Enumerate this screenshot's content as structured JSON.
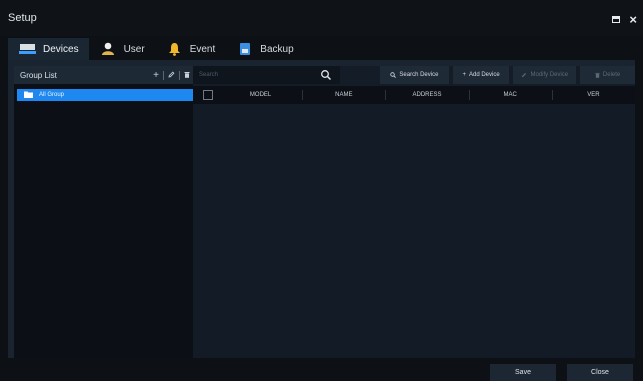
{
  "window": {
    "title": "Setup",
    "maximize_icon": "maximize-icon",
    "close_label": "×"
  },
  "tabs": [
    {
      "label": "Devices",
      "icon": "devices-icon",
      "active": true
    },
    {
      "label": "User",
      "icon": "user-icon",
      "active": false
    },
    {
      "label": "Event",
      "icon": "bell-icon",
      "active": false
    },
    {
      "label": "Backup",
      "icon": "backup-icon",
      "active": false
    }
  ],
  "group_panel": {
    "title": "Group List",
    "add_label": "+",
    "items": [
      {
        "label": "All Group",
        "selected": true
      }
    ]
  },
  "toolbar": {
    "search_placeholder": "Search",
    "search_device": "Search Device",
    "add_device": "Add Device",
    "modify_device": "Modify Device",
    "delete": "Delete"
  },
  "table": {
    "columns": [
      "MODEL",
      "NAME",
      "ADDRESS",
      "MAC",
      "VER"
    ],
    "rows": []
  },
  "footer": {
    "save": "Save",
    "close": "Close"
  },
  "colors": {
    "accent": "#1e88f0",
    "background": "#0d1116",
    "panel": "#1a2431"
  }
}
